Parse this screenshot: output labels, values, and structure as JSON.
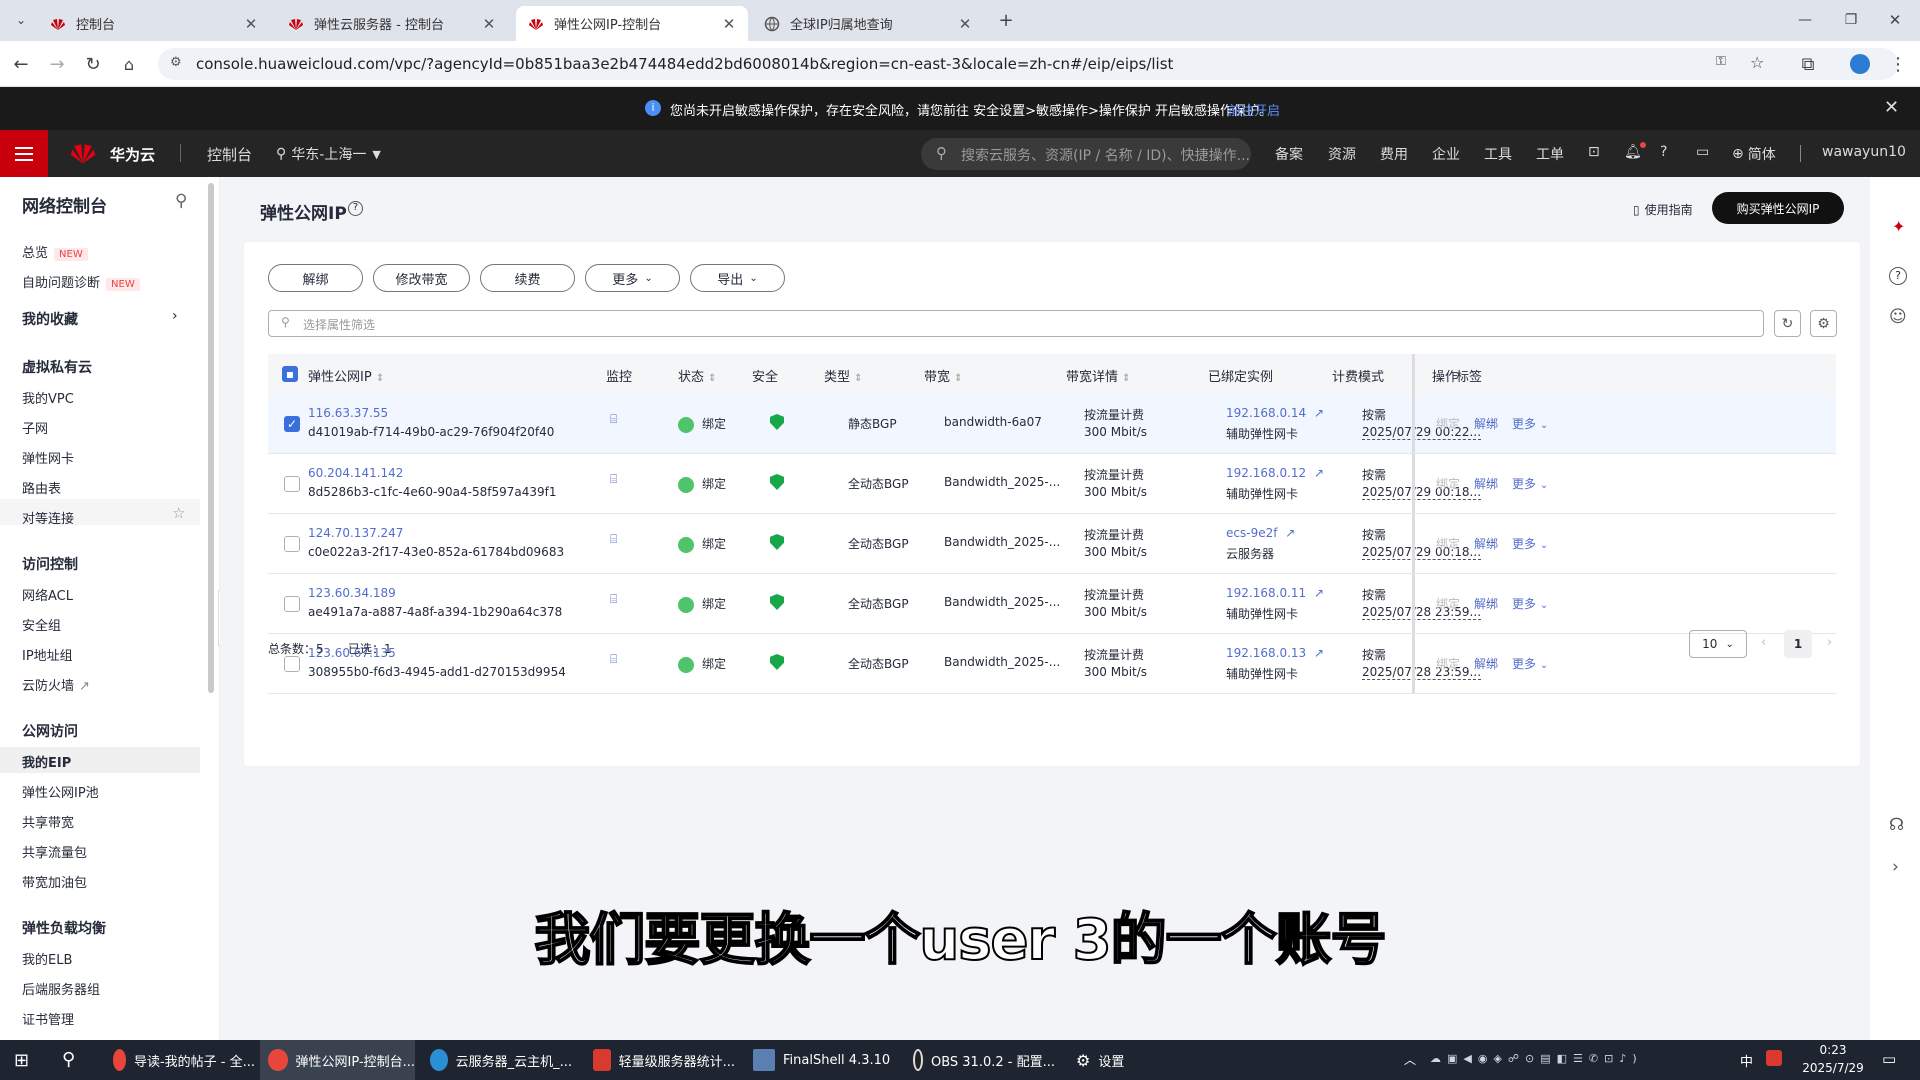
{
  "browser": {
    "tabs": [
      {
        "title": "控制台"
      },
      {
        "title": "弹性云服务器 - 控制台"
      },
      {
        "title": "弹性公网IP-控制台"
      },
      {
        "title": "全球IP归属地查询"
      }
    ],
    "url": "console.huaweicloud.com/vpc/?agencyId=0b851baa3e2b474484edd2bd6008014b&region=cn-east-3&locale=zh-cn#/eip/eips/list"
  },
  "banner": {
    "text": "您尚未开启敏感操作保护，存在安全风险，请您前往 安全设置>敏感操作>操作保护 开启敏感操作保护。",
    "link": "前往开启"
  },
  "header": {
    "brand": "华为云",
    "console": "控制台",
    "region": "华东-上海一",
    "search_placeholder": "搜索云服务、资源(IP / 名称 / ID)、快捷操作...",
    "nav": [
      "备案",
      "资源",
      "费用",
      "企业",
      "工具",
      "工单"
    ],
    "lang": "简体",
    "user": "wawayun10"
  },
  "sidebar": {
    "title": "网络控制台",
    "overview": "总览",
    "diag": "自助问题诊断",
    "new_badge": "NEW",
    "favorites": "我的收藏",
    "groups": [
      {
        "title": "虚拟私有云",
        "items": [
          "我的VPC",
          "子网",
          "弹性网卡",
          "路由表",
          "对等连接"
        ]
      },
      {
        "title": "访问控制",
        "items": [
          "网络ACL",
          "安全组",
          "IP地址组",
          "云防火墙"
        ]
      },
      {
        "title": "公网访问",
        "items": [
          "我的EIP",
          "弹性公网IP池",
          "共享带宽",
          "共享流量包",
          "带宽加油包"
        ]
      },
      {
        "title": "弹性负载均衡",
        "items": [
          "我的ELB",
          "后端服务器组",
          "证书管理"
        ]
      }
    ]
  },
  "page": {
    "title": "弹性公网IP",
    "guide": "使用指南",
    "buy": "购买弹性公网IP",
    "actions": [
      "解绑",
      "修改带宽",
      "续费",
      "更多",
      "导出"
    ],
    "filter_placeholder": "选择属性筛选",
    "columns": [
      "弹性公网IP",
      "监控",
      "状态",
      "安全",
      "类型",
      "带宽",
      "带宽详情",
      "已绑定实例",
      "计费模式",
      "标签",
      "操作"
    ],
    "rows": [
      {
        "ip": "116.63.37.55",
        "id": "d41019ab-f714-49b0-ac29-76f904f20f40",
        "status": "绑定",
        "type": "静态BGP",
        "bw": "bandwidth-6a07",
        "billing": "按流量计费",
        "speed": "300 Mbit/s",
        "inst": "192.168.0.14",
        "inst_type": "辅助弹性网卡",
        "mode": "按需",
        "date": "2025/07/29 00:22...",
        "tag": "--",
        "selected": true
      },
      {
        "ip": "60.204.141.142",
        "id": "8d5286b3-c1fc-4e60-90a4-58f597a439f1",
        "status": "绑定",
        "type": "全动态BGP",
        "bw": "Bandwidth_2025-...",
        "billing": "按流量计费",
        "speed": "300 Mbit/s",
        "inst": "192.168.0.12",
        "inst_type": "辅助弹性网卡",
        "mode": "按需",
        "date": "2025/07/29 00:18...",
        "tag": "--",
        "selected": false
      },
      {
        "ip": "124.70.137.247",
        "id": "c0e022a3-2f17-43e0-852a-61784bd09683",
        "status": "绑定",
        "type": "全动态BGP",
        "bw": "Bandwidth_2025-...",
        "billing": "按流量计费",
        "speed": "300 Mbit/s",
        "inst": "ecs-9e2f",
        "inst_type": "云服务器",
        "mode": "按需",
        "date": "2025/07/29 00:18...",
        "tag": "--",
        "selected": false
      },
      {
        "ip": "123.60.34.189",
        "id": "ae491a7a-a887-4a8f-a394-1b290a64c378",
        "status": "绑定",
        "type": "全动态BGP",
        "bw": "Bandwidth_2025-...",
        "billing": "按流量计费",
        "speed": "300 Mbit/s",
        "inst": "192.168.0.11",
        "inst_type": "辅助弹性网卡",
        "mode": "按需",
        "date": "2025/07/28 23:59...",
        "tag": "--",
        "selected": false
      },
      {
        "ip": "123.60.67.135",
        "id": "308955b0-f6d3-4945-add1-d270153d9954",
        "status": "绑定",
        "type": "全动态BGP",
        "bw": "Bandwidth_2025-...",
        "billing": "按流量计费",
        "speed": "300 Mbit/s",
        "inst": "192.168.0.13",
        "inst_type": "辅助弹性网卡",
        "mode": "按需",
        "date": "2025/07/28 23:59...",
        "tag": "--",
        "selected": false
      }
    ],
    "op_bind": "绑定",
    "op_unbind": "解绑",
    "op_more": "更多",
    "total": "总条数：5",
    "selected_count": "已选：1",
    "page_size": "10",
    "page_num": "1"
  },
  "subtitle": "我们要更换一个user 3的一个账号",
  "taskbar": {
    "apps": [
      "导读-我的帖子 - 全...",
      "弹性公网IP-控制台...",
      "云服务器_云主机_...",
      "轻量级服务器统计...",
      "FinalShell 4.3.10",
      "OBS 31.0.2 - 配置...",
      "设置"
    ],
    "ime": "中",
    "time": "0:23",
    "date": "2025/7/29"
  }
}
